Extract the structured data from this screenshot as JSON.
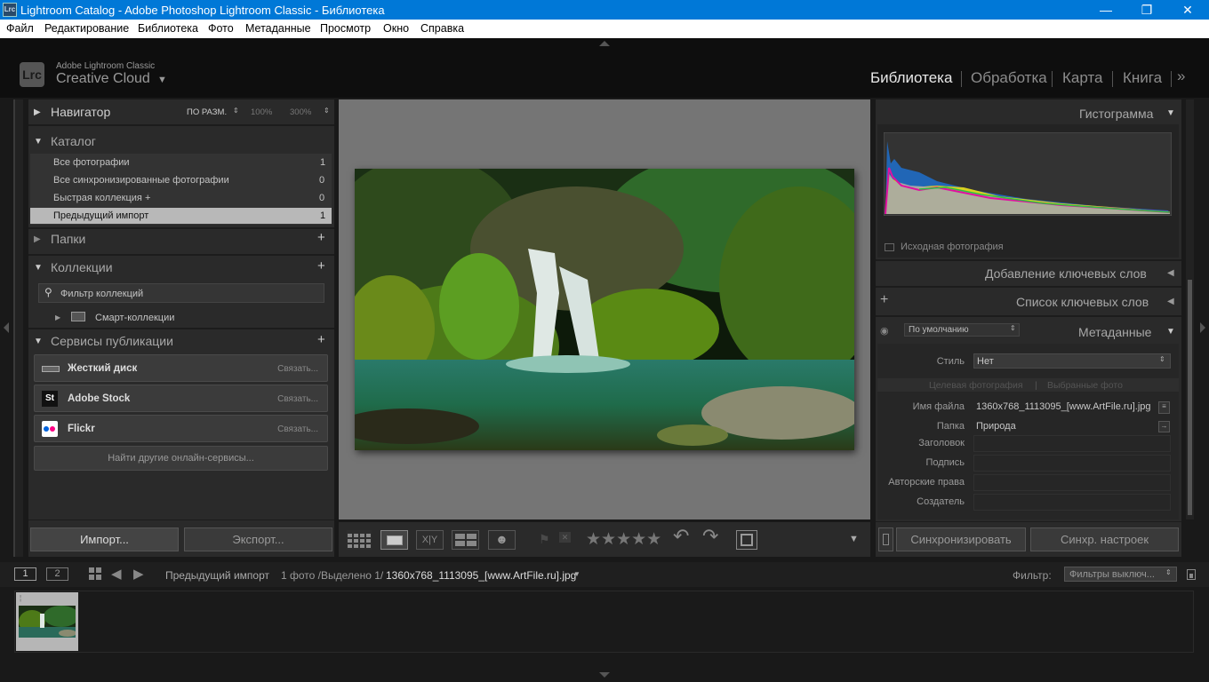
{
  "window": {
    "title": "Lightroom Catalog - Adobe Photoshop Lightroom Classic - Библиотека",
    "app_icon": "Lrc",
    "minimize": "—",
    "maximize": "❐",
    "close": "✕"
  },
  "menu": [
    "Файл",
    "Редактирование",
    "Библиотека",
    "Фото",
    "Метаданные",
    "Просмотр",
    "Окно",
    "Справка"
  ],
  "identity": {
    "logo": "Lrc",
    "line1": "Adobe Lightroom Classic",
    "line2": "Creative Cloud",
    "dropdown": "▼"
  },
  "modules": [
    "Библиотека",
    "Обработка",
    "Карта",
    "Книга"
  ],
  "modules_more": "»",
  "navigator": {
    "title": "Навигатор",
    "zoom": [
      "ПО РАЗМ.",
      "100%",
      "300%"
    ]
  },
  "catalog": {
    "title": "Каталог",
    "items": [
      {
        "label": "Все фотографии",
        "count": "1"
      },
      {
        "label": "Все синхронизированные фотографии",
        "count": "0"
      },
      {
        "label": "Быстрая коллекция  +",
        "count": "0"
      },
      {
        "label": "Предыдущий импорт",
        "count": "1"
      }
    ]
  },
  "folders": {
    "title": "Папки",
    "add": "+"
  },
  "collections": {
    "title": "Коллекции",
    "add": "+",
    "filter_placeholder": "Фильтр коллекций",
    "smart": "Смарт-коллекции"
  },
  "publish": {
    "title": "Сервисы публикации",
    "add": "+",
    "services": [
      {
        "name": "Жесткий диск",
        "link": "Связать..."
      },
      {
        "name": "Adobe Stock",
        "link": "Связать..."
      },
      {
        "name": "Flickr",
        "link": "Связать..."
      }
    ],
    "find_more": "Найти другие онлайн-сервисы..."
  },
  "left_buttons": {
    "import": "Импорт...",
    "export": "Экспорт..."
  },
  "right": {
    "histogram_title": "Гистограмма",
    "original_photo": "Исходная фотография",
    "keywording": "Добавление ключевых слов",
    "keyword_list": "Список ключевых слов",
    "keyword_add": "+",
    "metadata_preset": "По умолчанию",
    "metadata_title": "Метаданные",
    "style_label": "Стиль",
    "style_value": "Нет",
    "target_photo": "Целевая фотография",
    "selected_photos": "Выбранные фото",
    "fields": [
      {
        "label": "Имя файла",
        "value": "1360x768_1113095_[www.ArtFile.ru].jpg"
      },
      {
        "label": "Папка",
        "value": "Природа"
      },
      {
        "label": "Заголовок",
        "value": ""
      },
      {
        "label": "Подпись",
        "value": ""
      },
      {
        "label": "Авторские права",
        "value": ""
      },
      {
        "label": "Создатель",
        "value": ""
      }
    ],
    "sync": "Синхронизировать",
    "sync_settings": "Синхр. настроек"
  },
  "toolbar": {
    "stars": "★★★★★",
    "rotate_left": "↶",
    "rotate_right": "↷",
    "menu_arrow": "▼"
  },
  "filmstrip": {
    "screen1": "1",
    "screen2": "2",
    "source": "Предыдущий импорт",
    "count": "1 фото /",
    "selected": "Выделено 1/",
    "filename": "1360x768_1113095_[www.ArtFile.ru].jpg",
    "filter_label": "Фильтр:",
    "filter_value": "Фильтры выключ..."
  }
}
